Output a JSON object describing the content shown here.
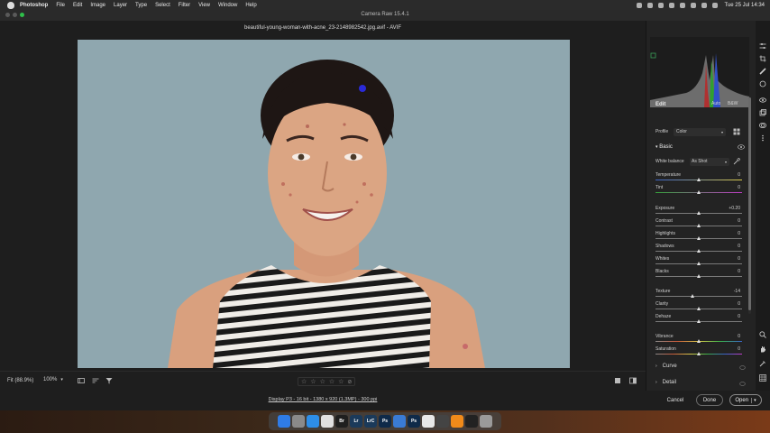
{
  "menubar": {
    "app_name": "Photoshop",
    "items": [
      "File",
      "Edit",
      "Image",
      "Layer",
      "Type",
      "Select",
      "Filter",
      "View",
      "Window",
      "Help"
    ],
    "clock": "Tue 25 Jul  14:34"
  },
  "window": {
    "title": "Camera Raw 15.4.1",
    "file_title": "beautiful-young-woman-with-acne_23-2148982542.jpg.avif  -  AVIF"
  },
  "bottom_bar": {
    "fit_label": "Fit (88.9%)",
    "zoom_value": "100%",
    "stars": [
      "☆",
      "☆",
      "☆",
      "☆",
      "☆"
    ]
  },
  "footer": {
    "workflow_text": "Display P3 - 16 bit - 1380 x 920 (1.3MP) - 300 ppi",
    "cancel_label": "Cancel",
    "done_label": "Done",
    "open_label": "Open"
  },
  "panel": {
    "edit_label": "Edit",
    "auto_label": "Auto",
    "bw_label": "B&W",
    "profile_label": "Profile",
    "profile_value": "Color",
    "basic_label": "Basic",
    "white_balance_label": "White balance",
    "white_balance_value": "As Shot",
    "sliders": [
      {
        "label": "Temperature",
        "value": "0",
        "pos": 0.5,
        "track": "temp"
      },
      {
        "label": "Tint",
        "value": "0",
        "pos": 0.5,
        "track": "tint"
      },
      {
        "label": "Exposure",
        "value": "+0.20",
        "pos": 0.51,
        "track": "plain"
      },
      {
        "label": "Contrast",
        "value": "0",
        "pos": 0.5,
        "track": "plain"
      },
      {
        "label": "Highlights",
        "value": "0",
        "pos": 0.5,
        "track": "plain"
      },
      {
        "label": "Shadows",
        "value": "0",
        "pos": 0.5,
        "track": "plain"
      },
      {
        "label": "Whites",
        "value": "0",
        "pos": 0.5,
        "track": "plain"
      },
      {
        "label": "Blacks",
        "value": "0",
        "pos": 0.5,
        "track": "plain"
      },
      {
        "label": "Texture",
        "value": "-14",
        "pos": 0.43,
        "track": "plain"
      },
      {
        "label": "Clarity",
        "value": "0",
        "pos": 0.5,
        "track": "plain"
      },
      {
        "label": "Dehaze",
        "value": "0",
        "pos": 0.5,
        "track": "plain"
      },
      {
        "label": "Vibrance",
        "value": "0",
        "pos": 0.5,
        "track": "vib"
      },
      {
        "label": "Saturation",
        "value": "0",
        "pos": 0.5,
        "track": "sat"
      }
    ],
    "sections": [
      "Curve",
      "Detail"
    ]
  },
  "dock": {
    "apps": [
      {
        "name": "finder",
        "label": "",
        "color": "#2f7ce6"
      },
      {
        "name": "launchpad",
        "label": "",
        "color": "#8a8a8a"
      },
      {
        "name": "safari",
        "label": "",
        "color": "#2d8ee8"
      },
      {
        "name": "chrome",
        "label": "",
        "color": "#e0e0e0"
      },
      {
        "name": "bridge",
        "label": "Br",
        "color": "#1f1f1f"
      },
      {
        "name": "lightroom",
        "label": "Lr",
        "color": "#1b3a5a"
      },
      {
        "name": "lightroom-classic",
        "label": "LrC",
        "color": "#1b3a5a"
      },
      {
        "name": "photoshop",
        "label": "Ps",
        "color": "#0f2a49"
      },
      {
        "name": "preview",
        "label": "",
        "color": "#3a7bd5"
      },
      {
        "name": "photoshop-beta",
        "label": "Ps",
        "color": "#0f2a49"
      },
      {
        "name": "photos",
        "label": "",
        "color": "#e8e8e8"
      },
      {
        "name": "disk-utility",
        "label": "",
        "color": "#444"
      },
      {
        "name": "vlc",
        "label": "",
        "color": "#f08a1a"
      },
      {
        "name": "terminal",
        "label": "",
        "color": "#222"
      },
      {
        "name": "trash",
        "label": "",
        "color": "#9a9a9a"
      }
    ]
  }
}
